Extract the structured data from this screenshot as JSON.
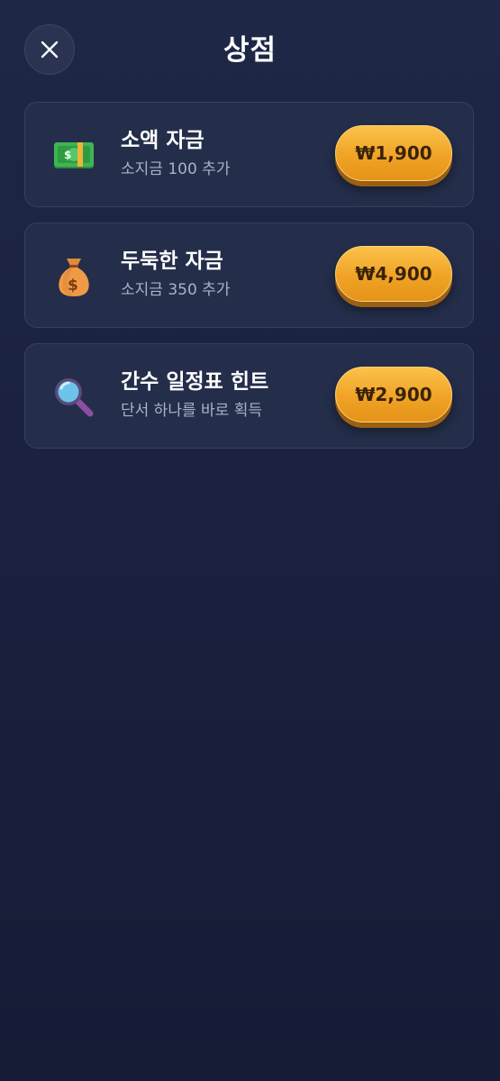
{
  "header": {
    "title": "상점",
    "close_icon": "close-icon"
  },
  "items": [
    {
      "icon": "cash-icon",
      "name": "소액 자금",
      "description": "소지금 100 추가",
      "price": "₩1,900"
    },
    {
      "icon": "money-bag-icon",
      "name": "두둑한 자금",
      "description": "소지금 350 추가",
      "price": "₩4,900"
    },
    {
      "icon": "magnifier-icon",
      "name": "간수 일정표 힌트",
      "description": "단서 하나를 바로 획득",
      "price": "₩2,900"
    }
  ],
  "colors": {
    "background": "#1a2240",
    "card": "#242e4a",
    "accent": "#f0a326",
    "price_text": "#3a2308"
  }
}
